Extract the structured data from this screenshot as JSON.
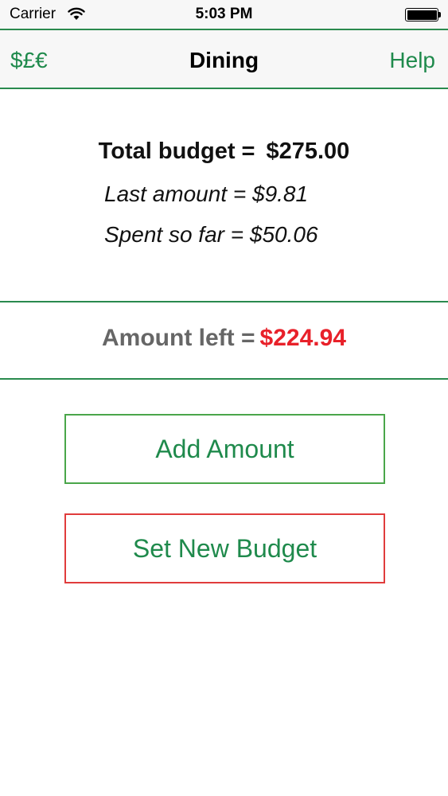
{
  "status_bar": {
    "carrier": "Carrier",
    "time": "5:03 PM"
  },
  "nav": {
    "left_label": "$£€",
    "title": "Dining",
    "right_label": "Help"
  },
  "budget": {
    "total_label": "Total budget =",
    "total_value": "$275.00",
    "last_amount_text": "Last amount = $9.81",
    "spent_text": "Spent so far = $50.06"
  },
  "amount_left": {
    "label": "Amount left =",
    "value": "$224.94"
  },
  "buttons": {
    "add_amount": "Add Amount",
    "set_new_budget": "Set New Budget"
  },
  "colors": {
    "accent_green": "#1f8a4c",
    "divider_green": "#2a8a4e",
    "amount_left_red": "#e8212a",
    "add_border": "#4aa64a",
    "reset_border": "#e03c3c"
  }
}
